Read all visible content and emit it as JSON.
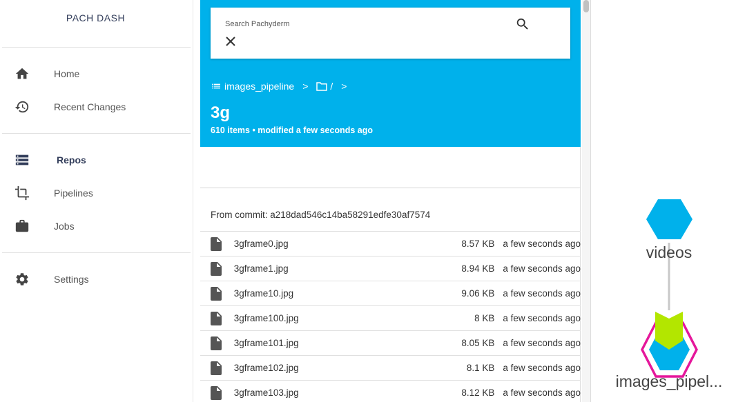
{
  "brand": "PACH DASH",
  "nav": {
    "group1": [
      {
        "label": "Home",
        "icon": "home-icon"
      },
      {
        "label": "Recent Changes",
        "icon": "history-icon"
      }
    ],
    "group2": [
      {
        "label": "Repos",
        "icon": "repos-list-icon",
        "active": true
      },
      {
        "label": "Pipelines",
        "icon": "crop-pipeline-icon"
      },
      {
        "label": "Jobs",
        "icon": "briefcase-icon"
      }
    ],
    "group3": [
      {
        "label": "Settings",
        "icon": "gear-icon"
      }
    ]
  },
  "search": {
    "label": "Search Pachyderm",
    "value": ""
  },
  "breadcrumb": {
    "repo": "images_pipeline",
    "sep1": ">",
    "path": "/",
    "sep2": ">"
  },
  "directory": {
    "name": "3g",
    "meta": "610 items • modified a few seconds ago"
  },
  "commit_text": "From commit: a218dad546c14ba58291edfe30af7574",
  "files": [
    {
      "name": "3gframe0.jpg",
      "size": "8.57 KB",
      "modified": "a few seconds ago"
    },
    {
      "name": "3gframe1.jpg",
      "size": "8.94 KB",
      "modified": "a few seconds ago"
    },
    {
      "name": "3gframe10.jpg",
      "size": "9.06 KB",
      "modified": "a few seconds ago"
    },
    {
      "name": "3gframe100.jpg",
      "size": "8 KB",
      "modified": "a few seconds ago"
    },
    {
      "name": "3gframe101.jpg",
      "size": "8.05 KB",
      "modified": "a few seconds ago"
    },
    {
      "name": "3gframe102.jpg",
      "size": "8.1 KB",
      "modified": "a few seconds ago"
    },
    {
      "name": "3gframe103.jpg",
      "size": "8.12 KB",
      "modified": "a few seconds ago"
    }
  ],
  "dag": {
    "repo_node": "videos",
    "pipeline_node": "images_pipel...",
    "colors": {
      "repo": "#00b1eb",
      "pipeline_fill": "#00b1eb",
      "pipeline_border": "#e5179b",
      "pipeline_chevron": "#b3e600",
      "edge": "#c8c8c8"
    }
  }
}
